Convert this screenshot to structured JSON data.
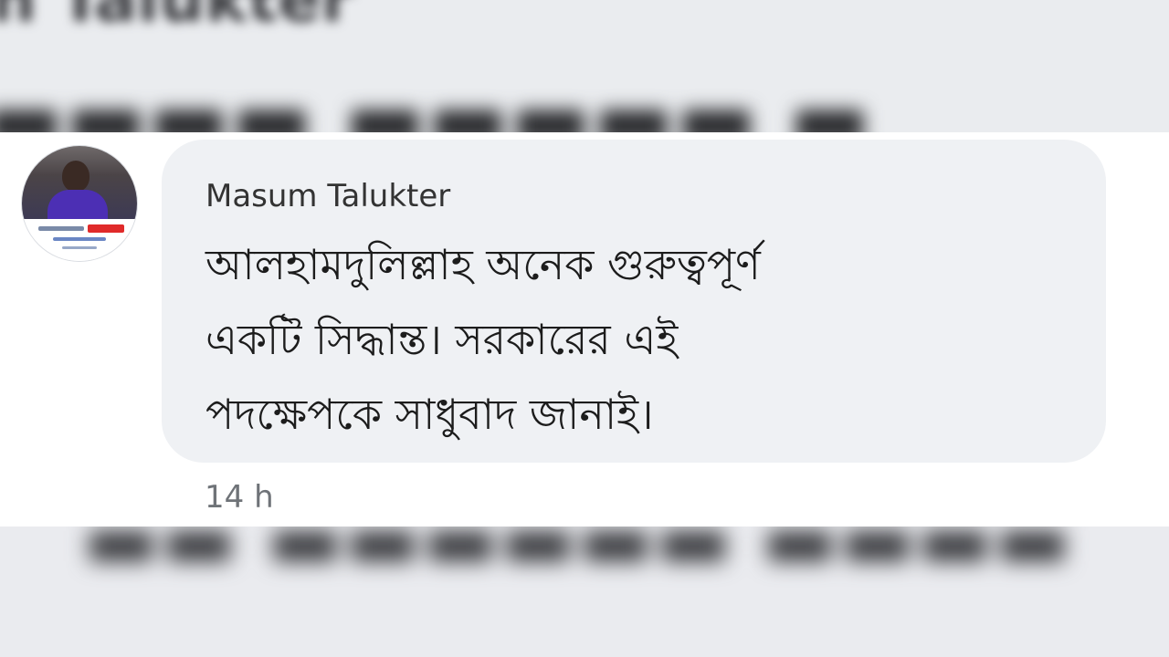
{
  "comment": {
    "author_name": "Masum Talukter",
    "text_lines": [
      "আলহামদুলিল্লাহ অনেক গুরুত্বপূর্ণ",
      "একটি সিদ্ধান্ত। সরকারের এই",
      "পদক্ষেপকে সাধুবাদ জানাই।"
    ],
    "time_ago": "14 h"
  },
  "background": {
    "top_blurred_text": "n Talukter",
    "bottom_blurred_text": ""
  },
  "colors": {
    "bubble": "#eff1f4",
    "author": "#333333",
    "text": "#1c1c1c",
    "timestamp": "#6f7378"
  }
}
